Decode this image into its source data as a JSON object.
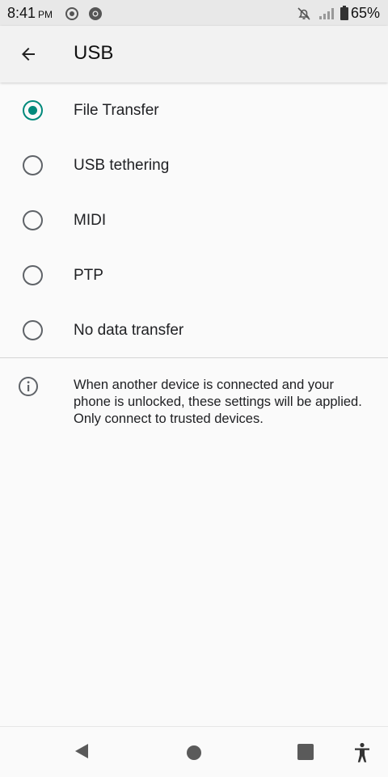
{
  "status_bar": {
    "time": "8:41",
    "ampm": "PM",
    "battery": "65%",
    "icons": [
      "record-icon",
      "chrome-icon",
      "notifications-off-icon",
      "signal-icon",
      "battery-icon"
    ]
  },
  "app_bar": {
    "title": "USB",
    "back_icon": "arrow-back-icon"
  },
  "options": [
    {
      "label": "File Transfer",
      "selected": true
    },
    {
      "label": "USB tethering",
      "selected": false
    },
    {
      "label": "MIDI",
      "selected": false
    },
    {
      "label": "PTP",
      "selected": false
    },
    {
      "label": "No data transfer",
      "selected": false
    }
  ],
  "footer": {
    "icon": "info-icon",
    "text": "When another device is connected and your phone is unlocked, these settings will be applied. Only connect to trusted devices."
  },
  "nav_bar": {
    "icons": [
      "back-nav-icon",
      "home-nav-icon",
      "recents-nav-icon",
      "accessibility-icon"
    ]
  },
  "colors": {
    "accent": "#00897b",
    "radio_off": "#5f6368",
    "background": "#fafafa"
  }
}
